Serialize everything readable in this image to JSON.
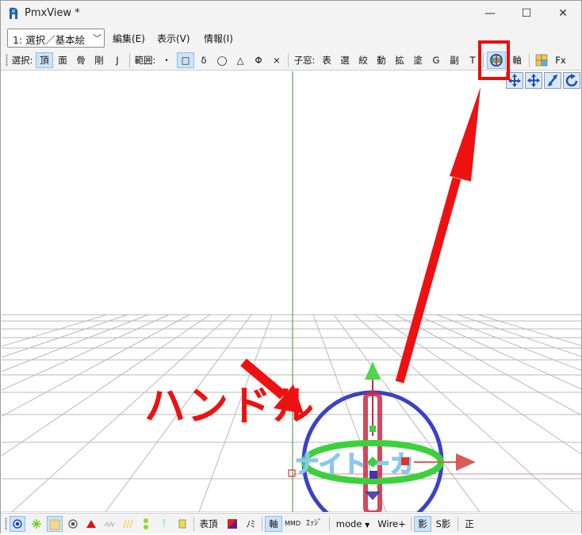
{
  "window": {
    "title": "PmxView *"
  },
  "window_controls": {
    "minimize": "—",
    "maximize": "☐",
    "close": "✕"
  },
  "mode_select": {
    "value": "1: 選択／基本絵"
  },
  "menu": [
    "編集(E)",
    "表示(V)",
    "情報(I)"
  ],
  "toolbar": {
    "select_label": "選択:",
    "select_items": [
      {
        "label": "頂",
        "active": true
      },
      {
        "label": "面",
        "active": false
      },
      {
        "label": "骨",
        "active": false
      },
      {
        "label": "剛",
        "active": false
      },
      {
        "label": "J",
        "active": false
      }
    ],
    "range_label": "範囲:",
    "range_items": [
      {
        "label": "・",
        "active": false
      },
      {
        "label": "□",
        "active": true
      },
      {
        "label": "δ",
        "active": false
      },
      {
        "label": "◯",
        "active": false
      },
      {
        "label": "△",
        "active": false
      },
      {
        "label": "Φ",
        "active": false
      },
      {
        "label": "×",
        "active": false
      }
    ],
    "subwin_label": "子窓:",
    "subwin_items": [
      "表",
      "選",
      "絞",
      "動",
      "拡",
      "塗",
      "G",
      "副",
      "T"
    ],
    "axis_label": "軸",
    "fx_label": "Fx"
  },
  "annotation": {
    "text": "ハンドル",
    "color": "#ee1111"
  },
  "handle_label": "ナイトーカ",
  "statusbar": {
    "vertex_label": "表頂",
    "nomi_label": "ﾉﾐ",
    "axis_label": "軸",
    "mmd_label": "MMD",
    "edge_label": "ｴｯｼﾞ",
    "mode_label": "mode",
    "wire_label": "Wire+",
    "shadow_label": "影",
    "sshadow_label": "S影",
    "front_label": "正"
  },
  "colors": {
    "chrome": "#f3f3f3",
    "accent_active": "#cce4f7",
    "annotation_red": "#ee1111",
    "handle_blue": "#3344cc",
    "handle_green": "#33cc33",
    "handle_red": "#cc2233"
  }
}
